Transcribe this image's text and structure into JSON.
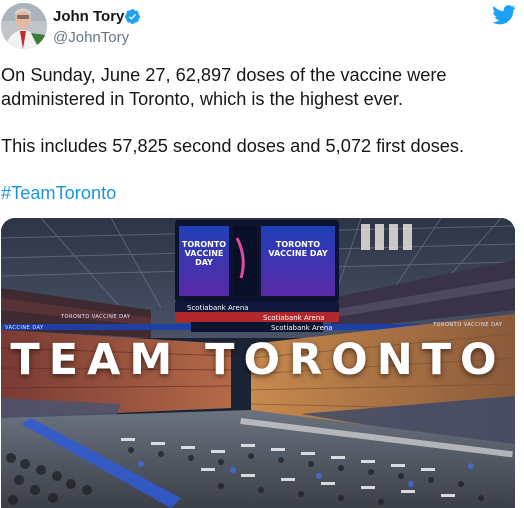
{
  "tweet": {
    "author": {
      "display_name": "John Tory",
      "handle": "@JohnTory",
      "verified": true,
      "verified_icon": "verified-badge-icon",
      "avatar_icon": "avatar"
    },
    "platform_icon": "twitter-bird-icon",
    "text": {
      "line1": "On Sunday, June 27, 62,897 doses of the vaccine were administered in Toronto, which is the highest ever.",
      "line2": "This includes 57,825 second doses and 5,072 first doses.",
      "hashtag": "#TeamToronto"
    },
    "media": {
      "overlay_title": "TEAM TORONTO",
      "scoreboard_left": "TORONTO VACCINE DAY",
      "scoreboard_right": "TORONTO VACCINE DAY",
      "scoreboard_top": "TORONTO VACCINE DAY",
      "sponsor_1": "Scotiabank Arena",
      "sponsor_2": "Scotiabank Arena",
      "sponsor_3": "Scotiabank Arena",
      "ribbon_left": "TORONTO VACCINE DAY",
      "ribbon_right": "TORONTO VACCINE DAY",
      "ribbon_far_left": "VACCINE DAY"
    }
  },
  "colors": {
    "text": "#14171a",
    "secondary_text": "#657786",
    "link": "#1b95e0",
    "verified_blue": "#1da1f2",
    "twitter_blue": "#1da1f2"
  }
}
